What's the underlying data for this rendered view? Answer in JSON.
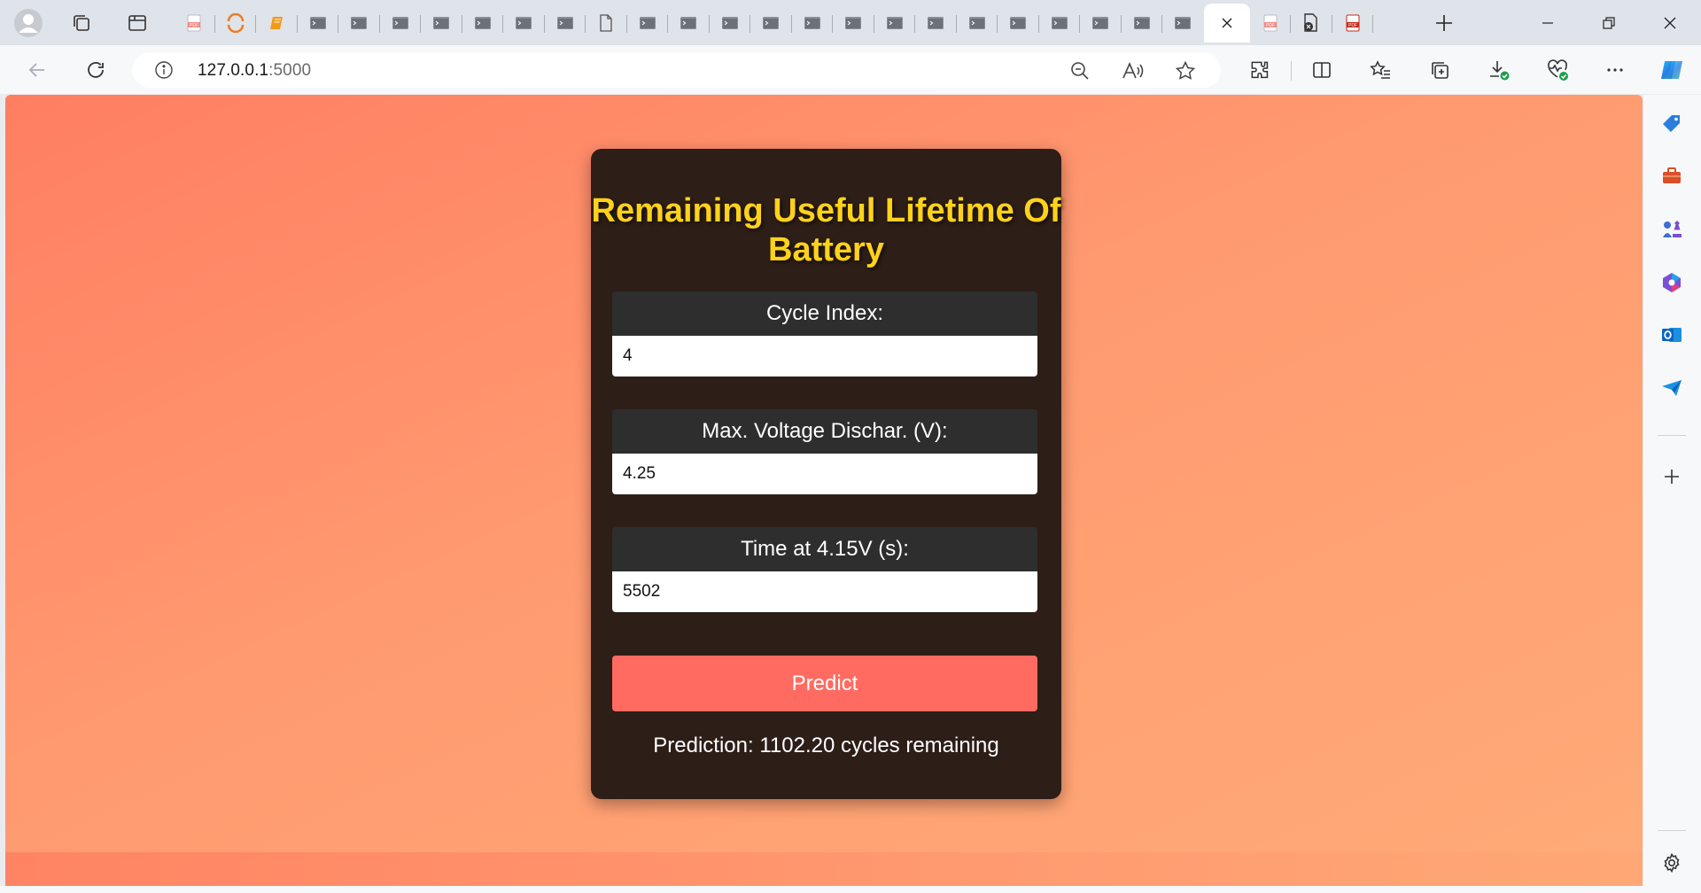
{
  "browser": {
    "address": {
      "host": "127.0.0.1",
      "port": ":5000"
    },
    "tabs": [
      {
        "icon": "pdf-icon"
      },
      {
        "icon": "orange-circle-icon"
      },
      {
        "icon": "book-icon"
      },
      {
        "icon": "terminal-icon"
      },
      {
        "icon": "terminal-icon"
      },
      {
        "icon": "terminal-icon"
      },
      {
        "icon": "terminal-icon"
      },
      {
        "icon": "terminal-icon"
      },
      {
        "icon": "terminal-icon"
      },
      {
        "icon": "terminal-icon"
      },
      {
        "icon": "document-icon"
      },
      {
        "icon": "terminal-icon"
      },
      {
        "icon": "terminal-icon"
      },
      {
        "icon": "terminal-icon"
      },
      {
        "icon": "terminal-icon"
      },
      {
        "icon": "terminal-icon"
      },
      {
        "icon": "terminal-icon"
      },
      {
        "icon": "terminal-icon"
      },
      {
        "icon": "terminal-icon"
      },
      {
        "icon": "terminal-icon"
      },
      {
        "icon": "terminal-icon"
      },
      {
        "icon": "terminal-icon"
      },
      {
        "icon": "terminal-icon"
      },
      {
        "icon": "terminal-icon"
      },
      {
        "icon": "terminal-icon"
      },
      {
        "icon": "close-icon",
        "active": true
      },
      {
        "icon": "pdf-icon"
      },
      {
        "icon": "settings-doc-icon"
      },
      {
        "icon": "pdf-red-icon"
      }
    ]
  },
  "page": {
    "title": "Remaining Useful Lifetime Of Battery",
    "fields": [
      {
        "label": "Cycle Index:",
        "value": "4"
      },
      {
        "label": "Max. Voltage Dischar. (V):",
        "value": "4.25"
      },
      {
        "label": "Time at 4.15V (s):",
        "value": "5502"
      }
    ],
    "predict_label": "Predict",
    "prediction_text": "Prediction: 1102.20 cycles remaining"
  },
  "colors": {
    "title": "#ffd21a",
    "card": "#2e1e18",
    "button": "#ff6b61",
    "background_start": "#ff7e62",
    "background_end": "#ffab78"
  }
}
